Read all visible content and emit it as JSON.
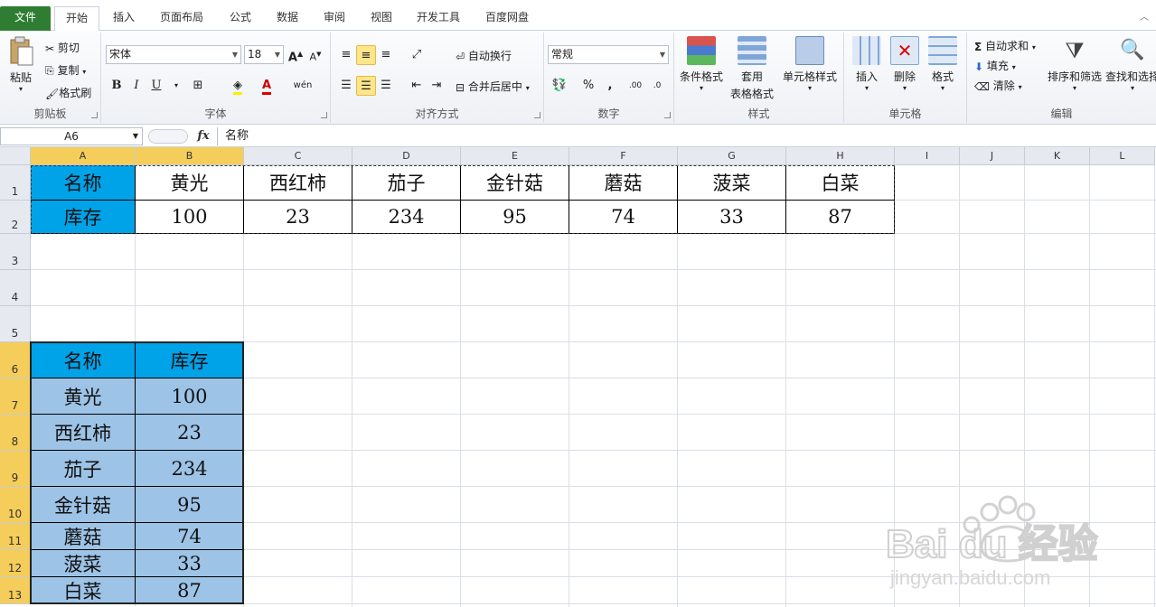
{
  "tabs": [
    "文件",
    "开始",
    "插入",
    "页面布局",
    "公式",
    "数据",
    "审阅",
    "视图",
    "开发工具",
    "百度网盘"
  ],
  "active_tab": "开始",
  "clipboard": {
    "paste": "粘贴",
    "cut": "剪切",
    "copy": "复制",
    "format_painter": "格式刷",
    "group": "剪贴板"
  },
  "font": {
    "name": "宋体",
    "size": "18",
    "group": "字体"
  },
  "align": {
    "wrap": "自动换行",
    "merge": "合并后居中",
    "group": "对齐方式"
  },
  "number": {
    "format": "常规",
    "group": "数字"
  },
  "styles": {
    "conditional": "条件格式",
    "table_line1": "套用",
    "table_line2": "表格格式",
    "cell_styles": "单元格样式",
    "group": "样式"
  },
  "cells": {
    "insert": "插入",
    "delete": "删除",
    "format": "格式",
    "group": "单元格"
  },
  "editing": {
    "autosum": "自动求和",
    "fill": "填充",
    "clear": "清除",
    "sort": "排序和筛选",
    "find": "查找和选择",
    "group": "编辑"
  },
  "formula_bar": {
    "name_box": "A6",
    "content": "名称"
  },
  "columns": [
    "A",
    "B",
    "C",
    "D",
    "E",
    "F",
    "G",
    "H",
    "I",
    "J",
    "K",
    "L"
  ],
  "rows": [
    "1",
    "2",
    "3",
    "4",
    "5",
    "6",
    "7",
    "8",
    "9",
    "10",
    "11",
    "12",
    "13"
  ],
  "top_table": {
    "row1": [
      "名称",
      "黄光",
      "西红柿",
      "茄子",
      "金针菇",
      "蘑菇",
      "菠菜",
      "白菜"
    ],
    "row2": [
      "库存",
      "100",
      "23",
      "234",
      "95",
      "74",
      "33",
      "87"
    ]
  },
  "transposed_table": {
    "header": [
      "名称",
      "库存"
    ],
    "rows": [
      [
        "黄光",
        "100"
      ],
      [
        "西红柿",
        "23"
      ],
      [
        "茄子",
        "234"
      ],
      [
        "金针菇",
        "95"
      ],
      [
        "蘑菇",
        "74"
      ],
      [
        "菠菜",
        "33"
      ],
      [
        "白菜",
        "87"
      ]
    ]
  },
  "colors": {
    "header_fill": "#00a2e8",
    "data_fill": "#9dc3e6",
    "selection_header": "#f4cd5b",
    "file_tab": "#2e7d32"
  },
  "watermark": {
    "brand": "Bai du 经验",
    "url": "jingyan.baidu.com"
  }
}
